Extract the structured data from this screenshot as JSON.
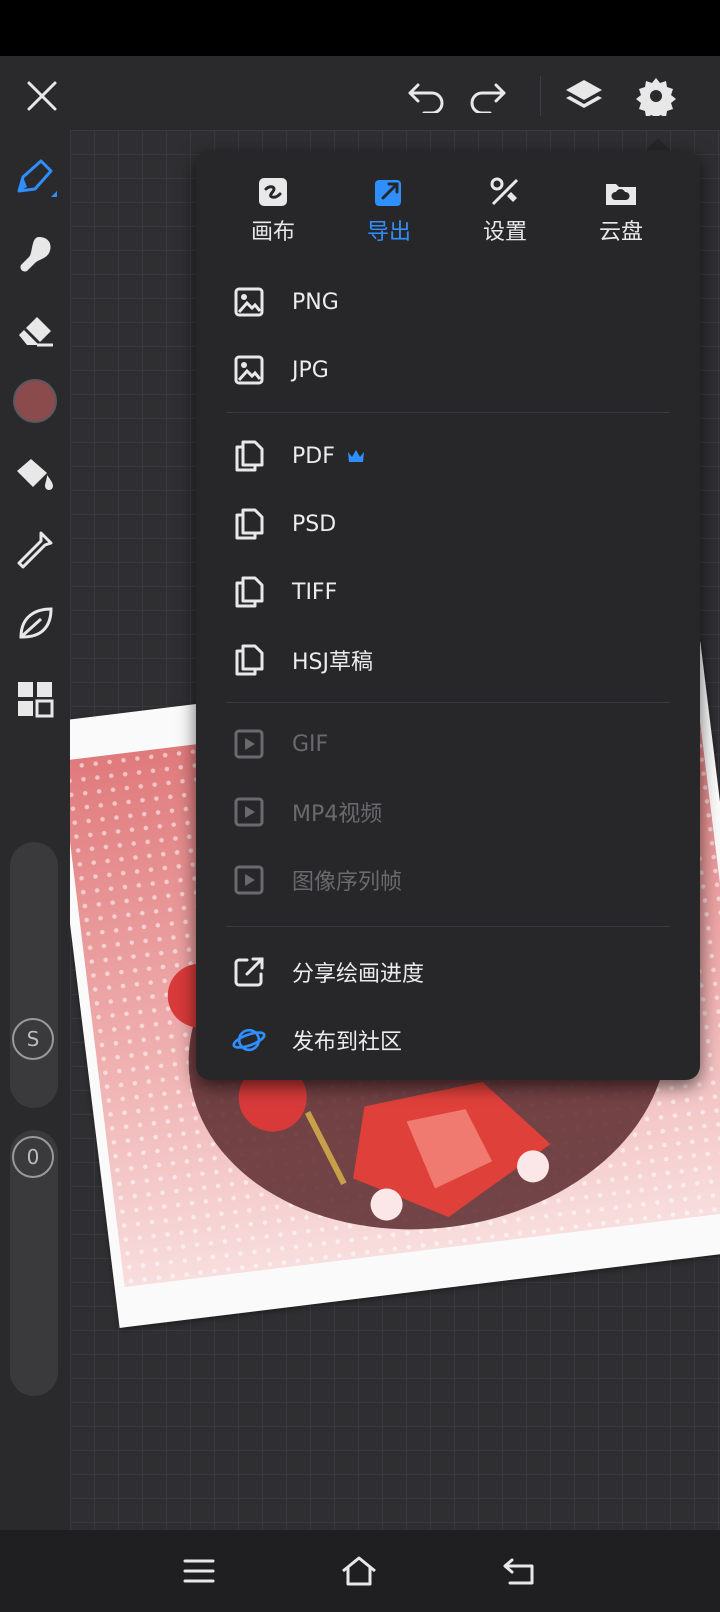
{
  "colors": {
    "accent": "#2f8fff",
    "popup_bg": "#27272a",
    "brush_color": "#8b4a4c"
  },
  "top_bar": {
    "close_icon": "close-icon",
    "undo_icon": "undo-icon",
    "redo_icon": "redo-icon",
    "layers_icon": "layers-icon",
    "settings_icon": "gear-icon"
  },
  "left_toolbar": {
    "tools": [
      "brush-icon",
      "smudge-icon",
      "eraser-icon",
      "color-swatch",
      "fill-bucket-icon",
      "eyedropper-icon",
      "leaf-icon",
      "grid-icon"
    ],
    "size_label": "S",
    "opacity_label": "0"
  },
  "popup": {
    "tabs": [
      {
        "label": "画布",
        "icon": "canvas-icon",
        "active": false
      },
      {
        "label": "导出",
        "icon": "export-icon",
        "active": true
      },
      {
        "label": "设置",
        "icon": "tools-icon",
        "active": false
      },
      {
        "label": "云盘",
        "icon": "cloud-icon",
        "active": false
      }
    ],
    "image_formats": [
      {
        "label": "PNG"
      },
      {
        "label": "JPG"
      }
    ],
    "document_formats": [
      {
        "label": "PDF",
        "premium": true
      },
      {
        "label": "PSD"
      },
      {
        "label": "TIFF"
      },
      {
        "label": "HSJ草稿"
      }
    ],
    "video_formats": [
      {
        "label": "GIF",
        "disabled": true
      },
      {
        "label": "MP4视频",
        "disabled": true
      },
      {
        "label": "图像序列帧",
        "disabled": true
      }
    ],
    "share": [
      {
        "label": "分享绘画进度",
        "icon": "share-icon"
      },
      {
        "label": "发布到社区",
        "icon": "planet-icon"
      }
    ]
  },
  "nav_bar": {
    "menu_icon": "menu-icon",
    "home_icon": "home-icon",
    "back_icon": "back-icon"
  }
}
